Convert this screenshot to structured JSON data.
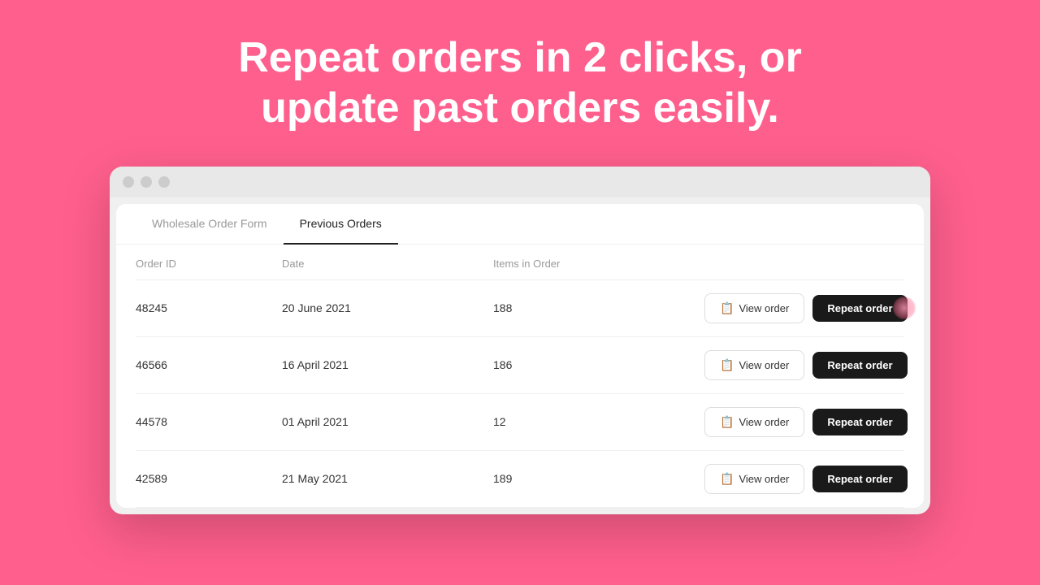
{
  "page": {
    "background_color": "#FF5F8D",
    "headline_line1": "Repeat orders in 2 clicks, or",
    "headline_line2": "update past orders easily."
  },
  "browser": {
    "dots": [
      "dot1",
      "dot2",
      "dot3"
    ]
  },
  "app": {
    "tabs": [
      {
        "id": "wholesale",
        "label": "Wholesale Order Form",
        "active": false
      },
      {
        "id": "previous",
        "label": "Previous Orders",
        "active": true
      }
    ],
    "table": {
      "headers": [
        "Order ID",
        "Date",
        "Items in Order",
        ""
      ],
      "rows": [
        {
          "order_id": "48245",
          "date": "20 June 2021",
          "items": "188",
          "highlighted": true
        },
        {
          "order_id": "46566",
          "date": "16 April 2021",
          "items": "186",
          "highlighted": false
        },
        {
          "order_id": "44578",
          "date": "01 April 2021",
          "items": "12",
          "highlighted": false
        },
        {
          "order_id": "42589",
          "date": "21 May 2021",
          "items": "189",
          "highlighted": false
        }
      ],
      "view_button_label": "View order",
      "repeat_button_label": "Repeat order"
    }
  }
}
